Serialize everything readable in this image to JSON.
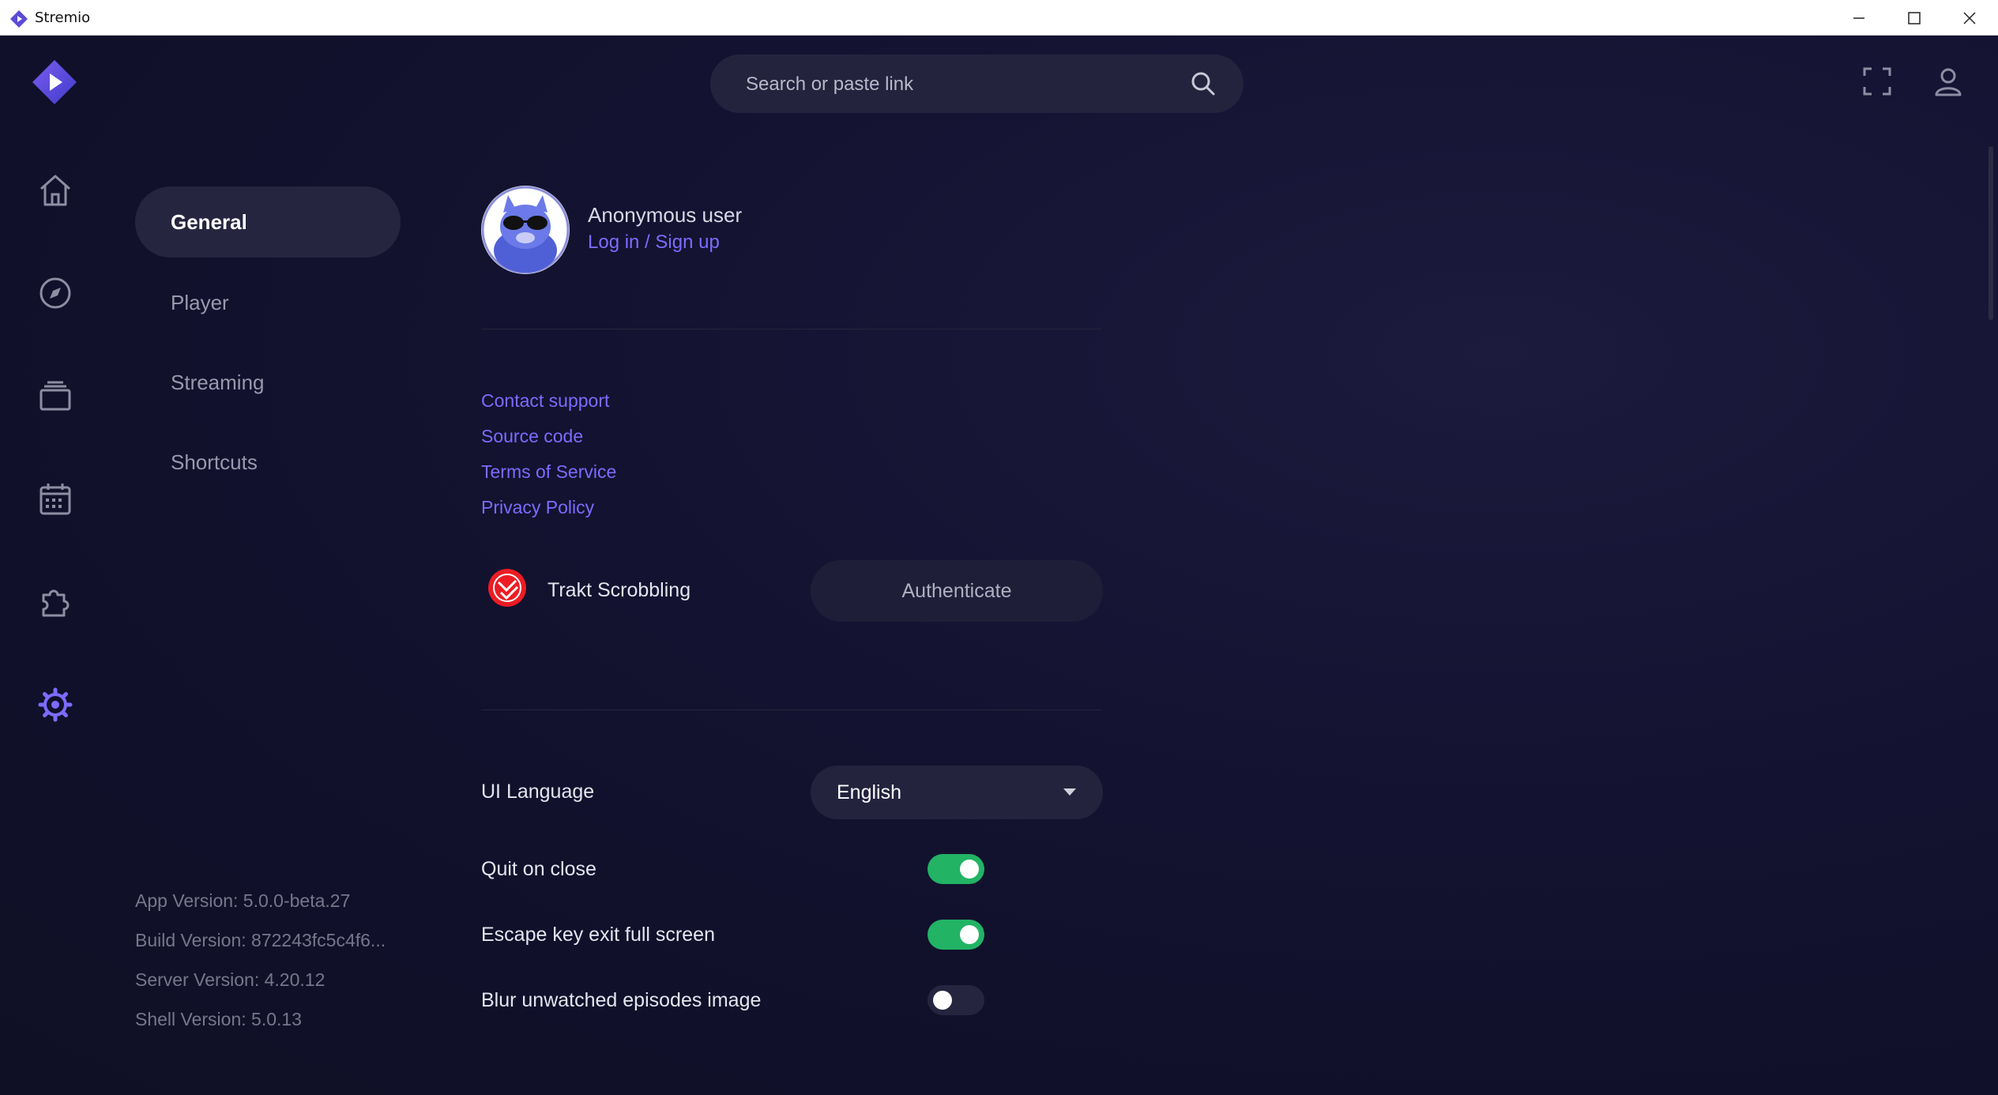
{
  "window": {
    "title": "Stremio"
  },
  "header": {
    "search_placeholder": "Search or paste link"
  },
  "nav": {
    "items": [
      {
        "name": "home-icon"
      },
      {
        "name": "discover-icon"
      },
      {
        "name": "library-icon"
      },
      {
        "name": "calendar-icon"
      },
      {
        "name": "addons-icon"
      },
      {
        "name": "settings-icon",
        "active": true
      }
    ]
  },
  "settings_menu": {
    "items": [
      {
        "label": "General",
        "active": true
      },
      {
        "label": "Player"
      },
      {
        "label": "Streaming"
      },
      {
        "label": "Shortcuts"
      }
    ]
  },
  "versions": {
    "app": "App Version: 5.0.0-beta.27",
    "build": "Build Version: 872243fc5c4f6...",
    "server": "Server Version: 4.20.12",
    "shell": "Shell Version: 5.0.13"
  },
  "profile": {
    "username": "Anonymous user",
    "login_link": "Log in / Sign up"
  },
  "links": {
    "contact": "Contact support",
    "source": "Source code",
    "terms": "Terms of Service",
    "privacy": "Privacy Policy"
  },
  "trakt": {
    "label": "Trakt Scrobbling",
    "button": "Authenticate"
  },
  "settings": {
    "ui_language": {
      "label": "UI Language",
      "value": "English"
    },
    "quit_on_close": {
      "label": "Quit on close",
      "enabled": true
    },
    "escape_exit": {
      "label": "Escape key exit full screen",
      "enabled": true
    },
    "blur_unwatched": {
      "label": "Blur unwatched episodes image",
      "enabled": false
    }
  },
  "colors": {
    "accent": "#7d6bff",
    "toggle_on": "#22b365",
    "background": "#131230"
  }
}
